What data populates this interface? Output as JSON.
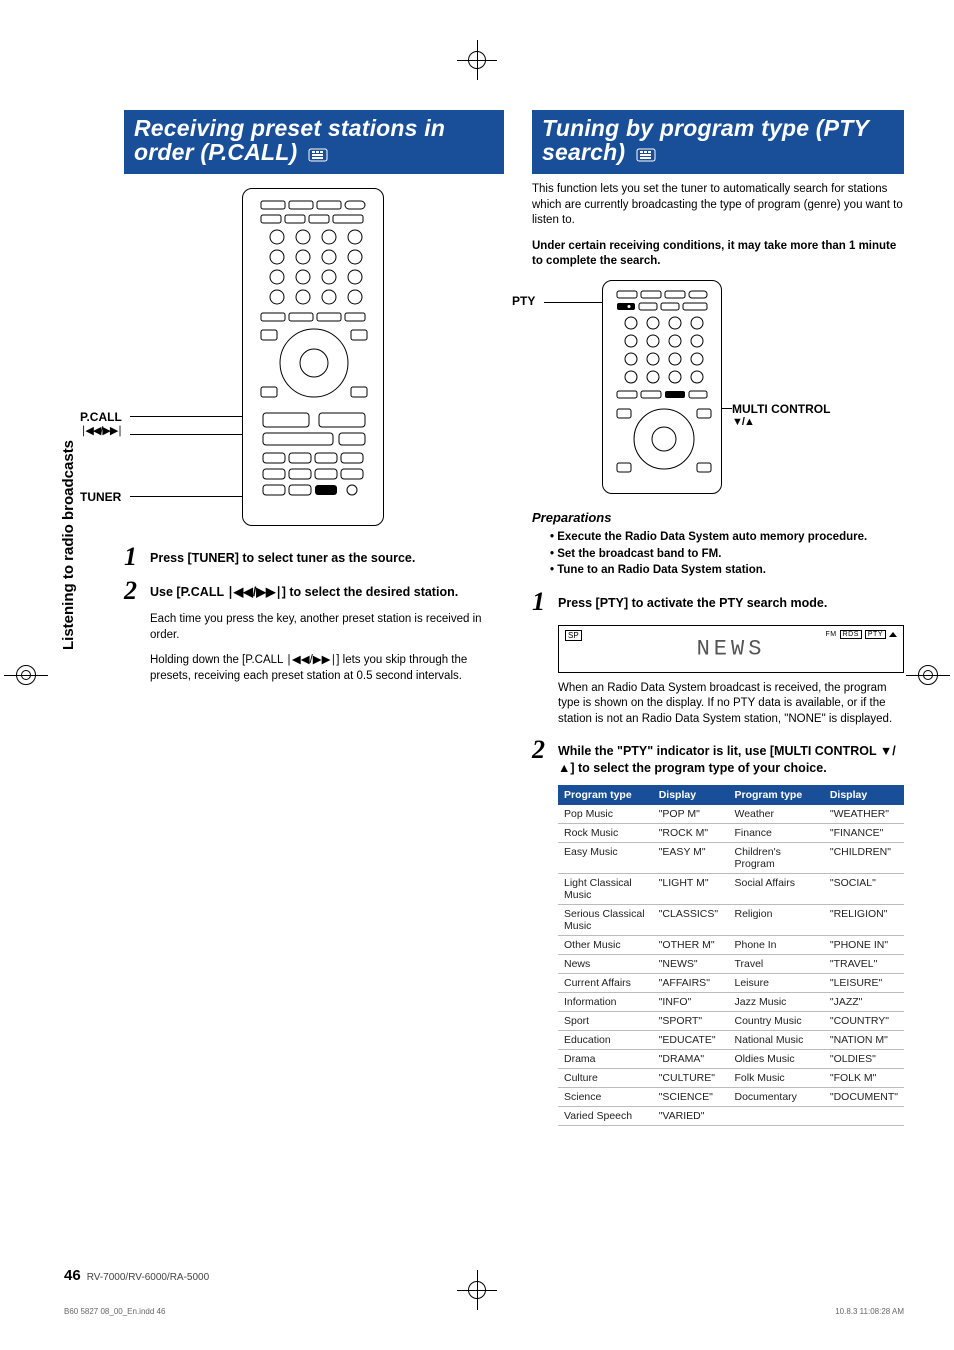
{
  "side_tab": "Listening to radio broadcasts",
  "left": {
    "title": "Receiving preset stations in order (P.CALL)",
    "remote_labels": {
      "pcall": "P.CALL",
      "pcall_sym": "∣◀◀/▶▶∣",
      "tuner": "TUNER"
    },
    "step1": "Press [TUNER] to select tuner as the source.",
    "step2": "Use [P.CALL ∣◀◀/▶▶∣] to select the desired station.",
    "body1": "Each time you press the key, another preset station is received in order.",
    "body2": "Holding down the [P.CALL ∣◀◀/▶▶∣] lets you skip through the presets, receiving each preset station at 0.5 second intervals."
  },
  "right": {
    "title": "Tuning by program type (PTY search)",
    "intro": "This function lets you set the tuner to automatically search for stations which are currently broadcasting the type of program (genre) you want to listen to.",
    "warn": "Under certain receiving conditions, it may take more than 1 minute to complete the search.",
    "remote_labels": {
      "pty": "PTY",
      "multi": "MULTI CONTROL",
      "multi_sym": "▼/▲"
    },
    "prep_head": "Preparations",
    "prep": [
      "Execute the Radio Data System auto memory procedure.",
      "Set the broadcast band to FM.",
      "Tune to an Radio Data System station."
    ],
    "step1": "Press [PTY] to activate the PTY search mode.",
    "lcd": {
      "sp": "SP",
      "seg": "NEWS",
      "fm": "FM",
      "rds": "RDS",
      "pty": "PTY"
    },
    "after_lcd": "When an Radio Data System broadcast is received, the program type is shown on the display. If no PTY data is available, or if the station is not an Radio Data System station, \"NONE\" is displayed.",
    "step2": "While the \"PTY\" indicator is lit, use [MULTI CONTROL ▼/▲] to select the program type of your choice.",
    "table_headers": [
      "Program type",
      "Display",
      "Program type",
      "Display"
    ],
    "table_rows": [
      [
        "Pop Music",
        "\"POP M\"",
        "Weather",
        "\"WEATHER\""
      ],
      [
        "Rock Music",
        "\"ROCK M\"",
        "Finance",
        "\"FINANCE\""
      ],
      [
        "Easy Music",
        "\"EASY M\"",
        "Children's Program",
        "\"CHILDREN\""
      ],
      [
        "Light Classical Music",
        "\"LIGHT M\"",
        "Social Affairs",
        "\"SOCIAL\""
      ],
      [
        "Serious Classical Music",
        "\"CLASSICS\"",
        "Religion",
        "\"RELIGION\""
      ],
      [
        "Other Music",
        "\"OTHER M\"",
        "Phone In",
        "\"PHONE IN\""
      ],
      [
        "News",
        "\"NEWS\"",
        "Travel",
        "\"TRAVEL\""
      ],
      [
        "Current Affairs",
        "\"AFFAIRS\"",
        "Leisure",
        "\"LEISURE\""
      ],
      [
        "Information",
        "\"INFO\"",
        "Jazz Music",
        "\"JAZZ\""
      ],
      [
        "Sport",
        "\"SPORT\"",
        "Country Music",
        "\"COUNTRY\""
      ],
      [
        "Education",
        "\"EDUCATE\"",
        "National Music",
        "\"NATION M\""
      ],
      [
        "Drama",
        "\"DRAMA\"",
        "Oldies Music",
        "\"OLDIES\""
      ],
      [
        "Culture",
        "\"CULTURE\"",
        "Folk Music",
        "\"FOLK M\""
      ],
      [
        "Science",
        "\"SCIENCE\"",
        "Documentary",
        "\"DOCUMENT\""
      ],
      [
        "Varied Speech",
        "\"VARIED\"",
        "",
        ""
      ]
    ]
  },
  "footer": {
    "page": "46",
    "models": "RV-7000/RV-6000/RA-5000"
  },
  "print": {
    "file": "B60 5827 08_00_En.indd   46",
    "time": "10.8.3   11:08:28 AM"
  }
}
